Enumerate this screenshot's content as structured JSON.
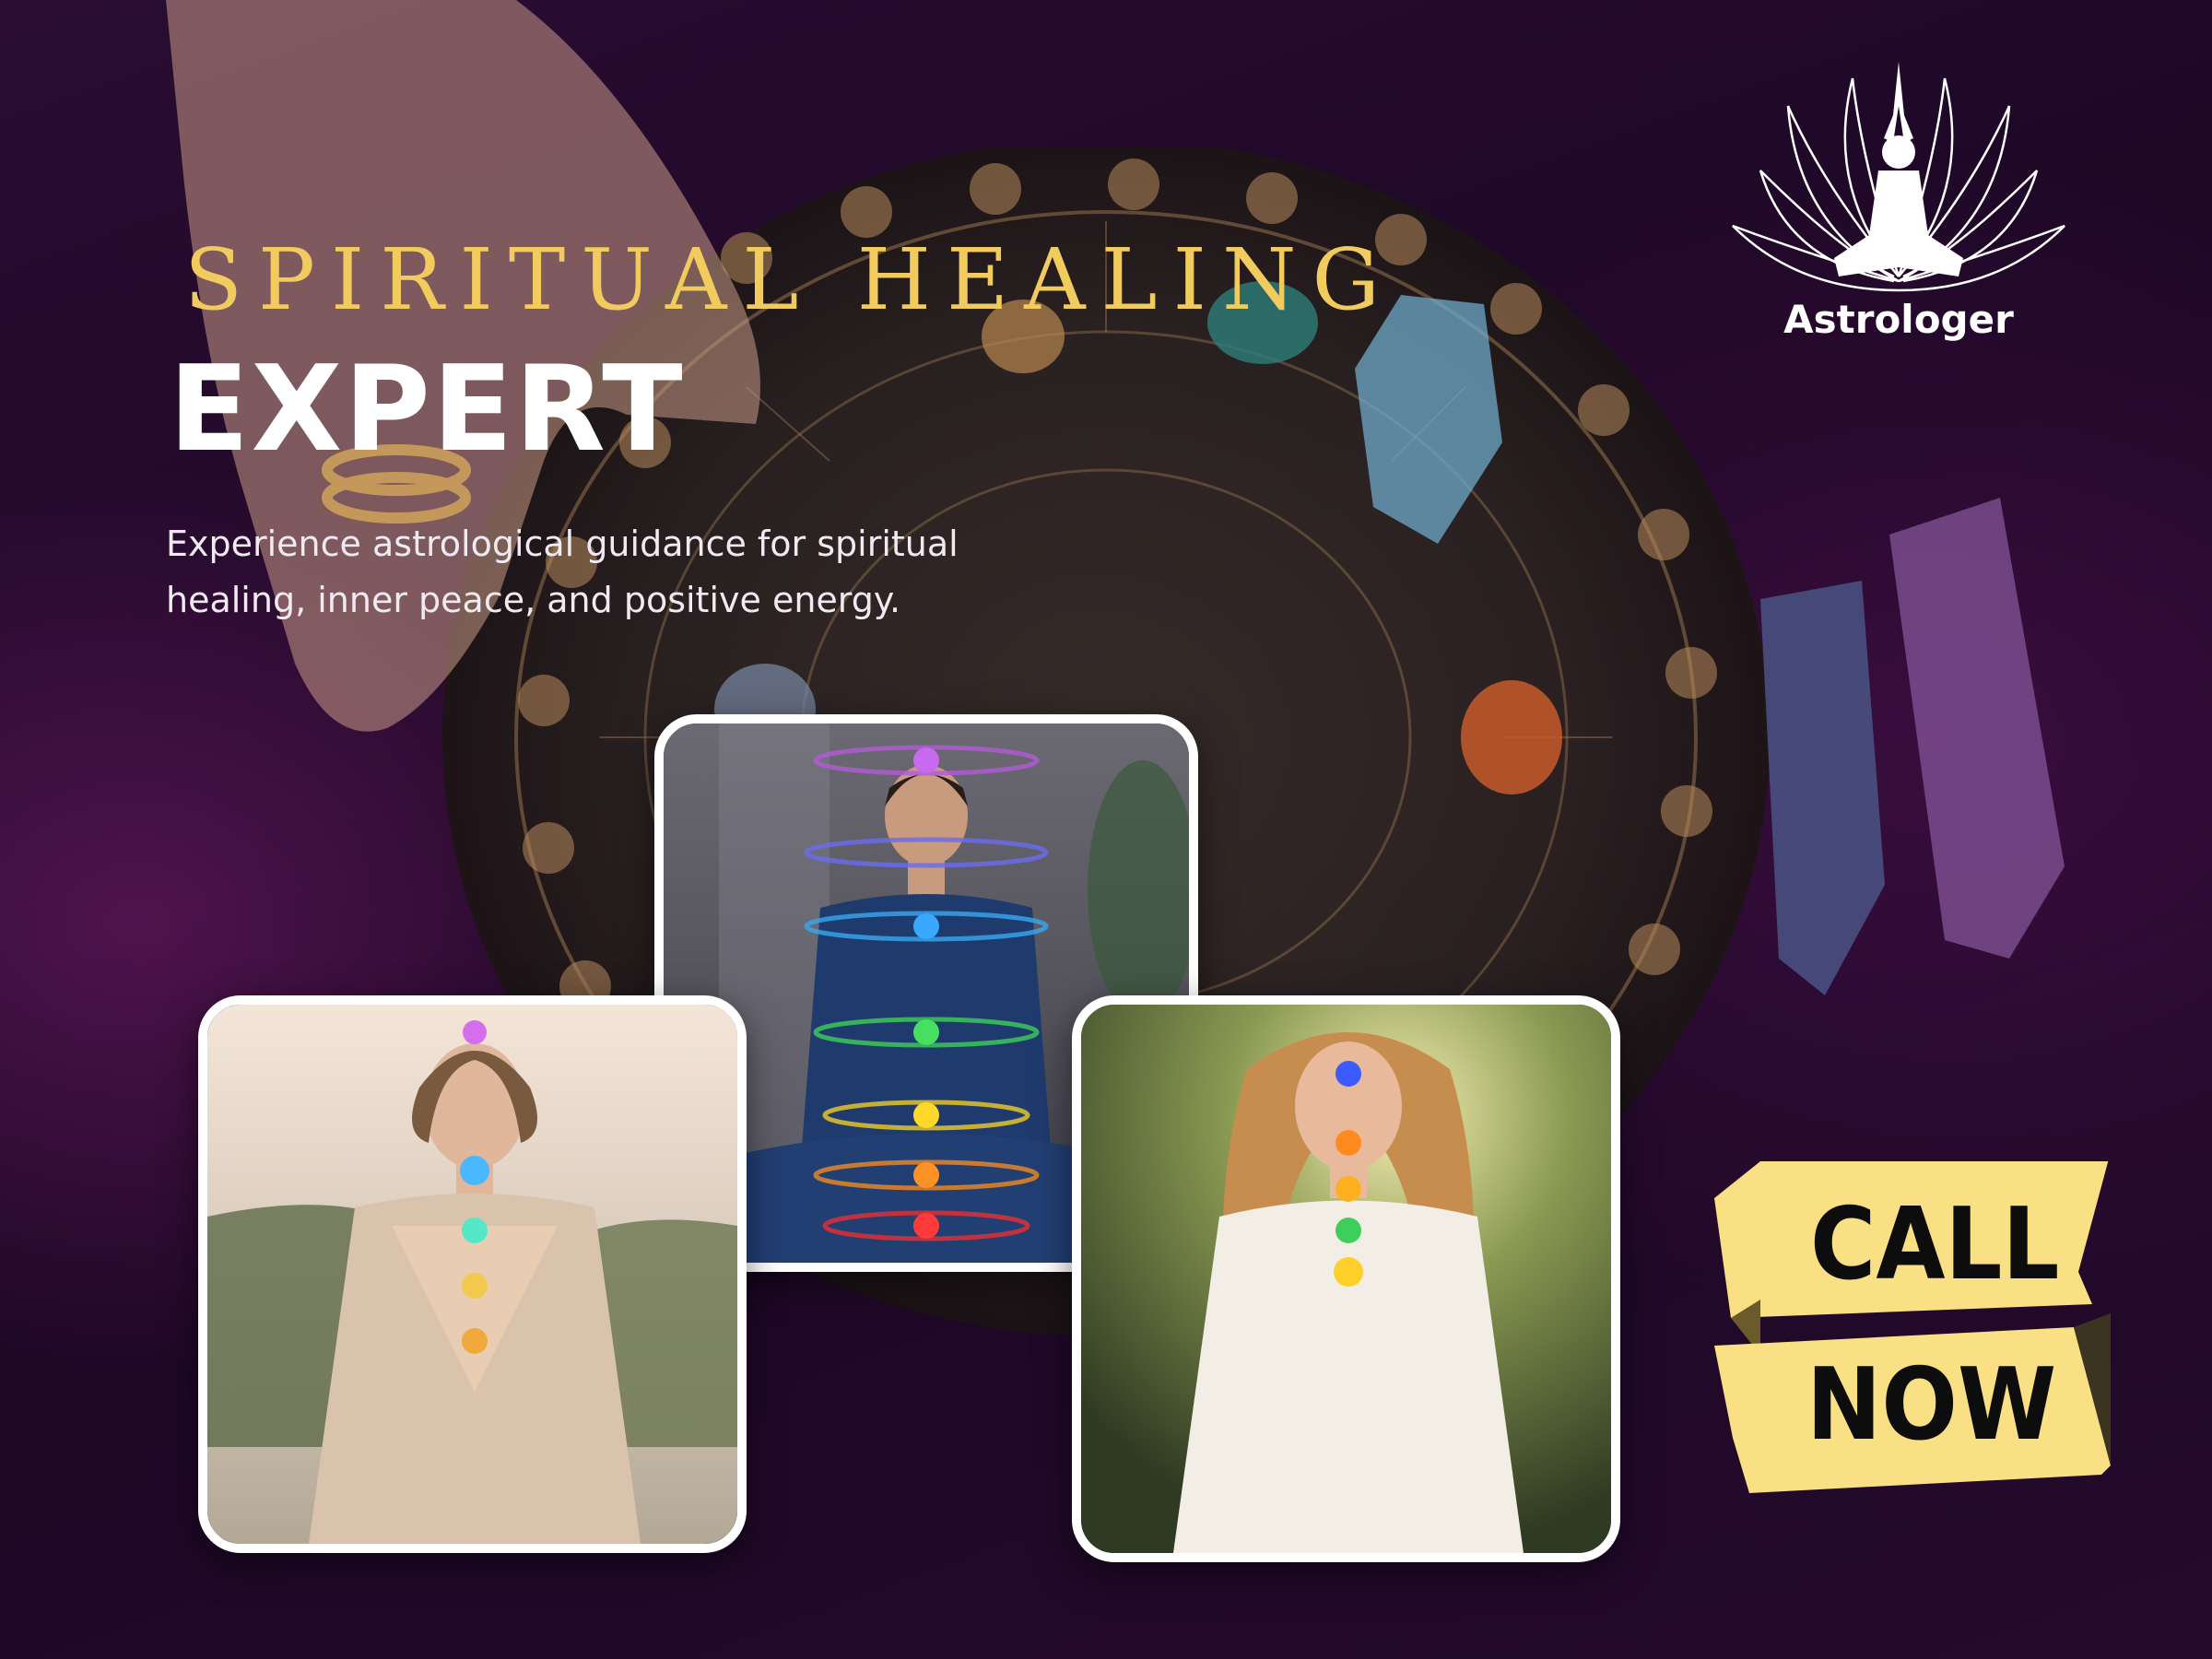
{
  "banner": {
    "headline_line1": "SPIRITUAL HEALING",
    "headline_line2": "EXPERT",
    "description": "Experience astrological guidance for spiritual healing, inner peace, and positive energy."
  },
  "brand": {
    "name": "Astrologer",
    "logo_icon": "meditating-lotus-icon"
  },
  "cta": {
    "line1": "CALL",
    "line2": "NOW"
  },
  "photos": [
    {
      "id": "meditation-chakra-photo-left",
      "subject": "woman meditating outdoors with glowing chakras"
    },
    {
      "id": "meditation-chakra-photo-center",
      "subject": "woman in blue dress meditating with chakra rings"
    },
    {
      "id": "meditation-chakra-photo-right",
      "subject": "woman in white meditating in sunlit garden"
    }
  ],
  "colors": {
    "background": "#1c0724",
    "headline_gold": "#f1cb5e",
    "cta_yellow": "#f9e084",
    "text_white": "#ffffff"
  }
}
